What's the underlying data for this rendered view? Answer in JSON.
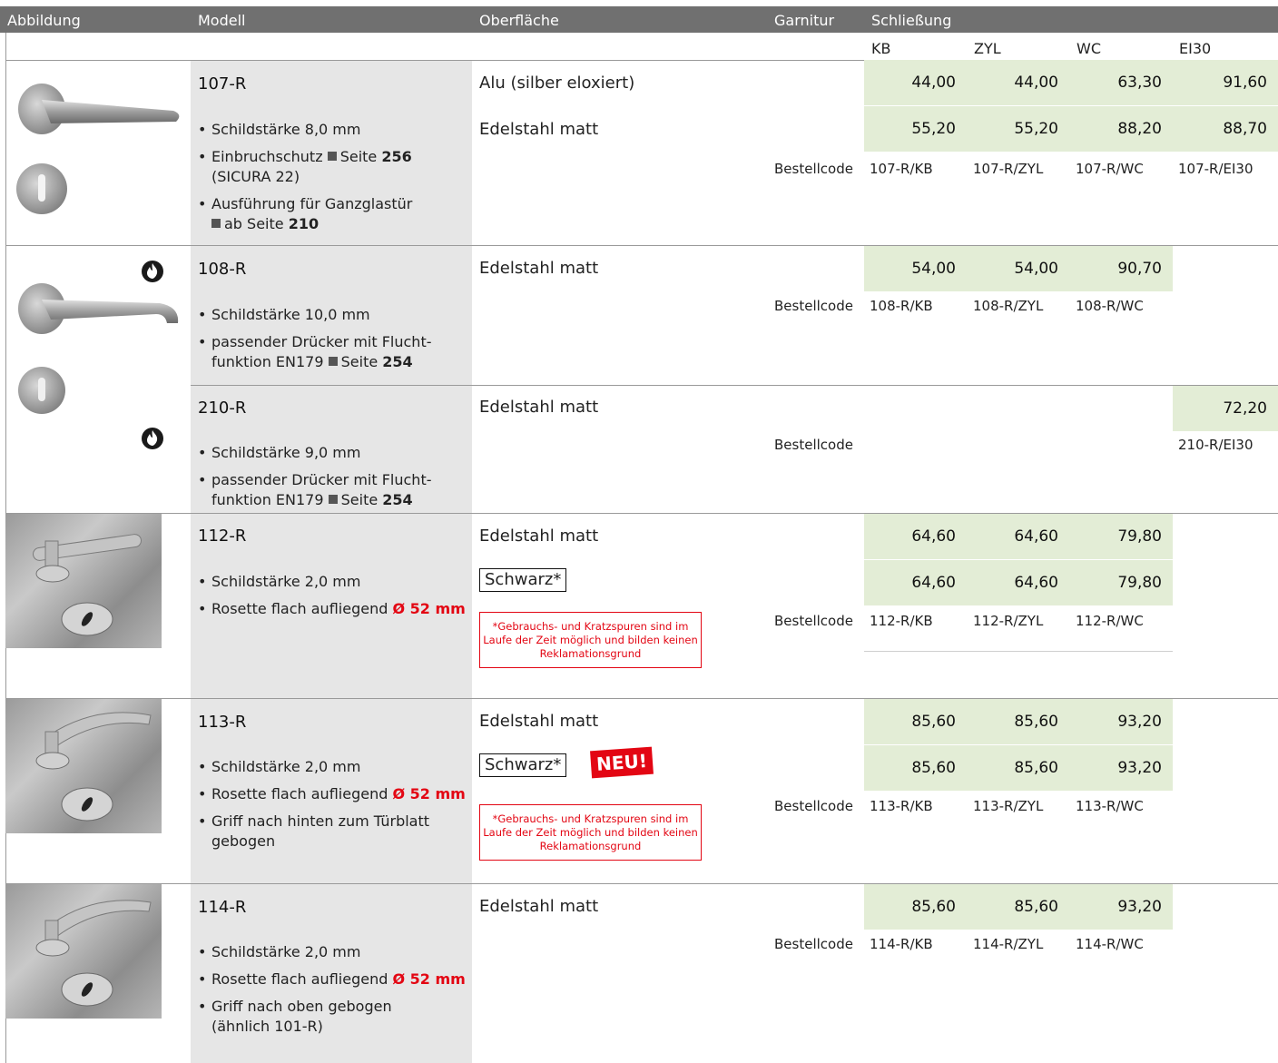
{
  "header": {
    "abbildung": "Abbildung",
    "modell": "Modell",
    "oberflaeche": "Oberfläche",
    "garnitur": "Garnitur",
    "schliessung": "Schließung"
  },
  "columns": {
    "kb": "KB",
    "zyl": "ZYL",
    "wc": "WC",
    "ei30": "EI30"
  },
  "bestellcode_label": "Bestellcode",
  "note_text": "*Gebrauchs- und Kratzspuren sind im Laufe der Zeit möglich und bilden keinen Reklamationsgrund",
  "neu_badge": "NEU!",
  "rows": {
    "r107": {
      "model": "107-R",
      "bullets": {
        "b1": "Schildstärke 8,0 mm",
        "b2a": "Einbruchschutz",
        "b2b": "Seite",
        "b2c": "256",
        "b2d": "(SICURA 22)",
        "b3a": "Ausführung für Ganzglastür",
        "b3b": "ab Seite",
        "b3c": "210"
      },
      "finishes": [
        "Alu (silber eloxiert)",
        "Edelstahl matt"
      ],
      "prices": [
        [
          "44,00",
          "44,00",
          "63,30",
          "91,60"
        ],
        [
          "55,20",
          "55,20",
          "88,20",
          "88,70"
        ]
      ],
      "codes": [
        "107-R/KB",
        "107-R/ZYL",
        "107-R/WC",
        "107-R/EI30"
      ]
    },
    "r108": {
      "model": "108-R",
      "bullets": {
        "b1": "Schildstärke 10,0 mm",
        "b2a": "passender Drücker mit Flucht-",
        "b2b": "funktion EN179",
        "b2c": "Seite",
        "b2d": "254"
      },
      "finishes": [
        "Edelstahl matt"
      ],
      "prices": [
        [
          "54,00",
          "54,00",
          "90,70"
        ]
      ],
      "codes": [
        "108-R/KB",
        "108-R/ZYL",
        "108-R/WC"
      ]
    },
    "r210": {
      "model": "210-R",
      "bullets": {
        "b1": "Schildstärke 9,0 mm",
        "b2a": "passender Drücker mit Flucht-",
        "b2b": "funktion EN179",
        "b2c": "Seite",
        "b2d": "254"
      },
      "finishes": [
        "Edelstahl matt"
      ],
      "price_ei30": "72,20",
      "code_ei30": "210-R/EI30"
    },
    "r112": {
      "model": "112-R",
      "bullets": {
        "b1": "Schildstärke 2,0 mm",
        "b2a": "Rosette flach aufliegend",
        "b2b": "Ø 52 mm"
      },
      "finishes": [
        "Edelstahl matt",
        "Schwarz*"
      ],
      "prices": [
        [
          "64,60",
          "64,60",
          "79,80"
        ],
        [
          "64,60",
          "64,60",
          "79,80"
        ]
      ],
      "codes": [
        "112-R/KB",
        "112-R/ZYL",
        "112-R/WC"
      ]
    },
    "r113": {
      "model": "113-R",
      "bullets": {
        "b1": "Schildstärke 2,0 mm",
        "b2a": "Rosette flach aufliegend",
        "b2b": "Ø 52 mm",
        "b3a": "Griff nach hinten zum Türblatt",
        "b3b": "gebogen"
      },
      "finishes": [
        "Edelstahl matt",
        "Schwarz*"
      ],
      "prices": [
        [
          "85,60",
          "85,60",
          "93,20"
        ],
        [
          "85,60",
          "85,60",
          "93,20"
        ]
      ],
      "codes": [
        "113-R/KB",
        "113-R/ZYL",
        "113-R/WC"
      ]
    },
    "r114": {
      "model": "114-R",
      "bullets": {
        "b1": "Schildstärke 2,0 mm",
        "b2a": "Rosette flach aufliegend",
        "b2b": "Ø 52 mm",
        "b3a": "Griff nach oben gebogen",
        "b3b": "(ähnlich 101-R)"
      },
      "finishes": [
        "Edelstahl matt"
      ],
      "prices": [
        [
          "85,60",
          "85,60",
          "93,20"
        ]
      ],
      "codes": [
        "114-R/KB",
        "114-R/ZYL",
        "114-R/WC"
      ]
    }
  },
  "icons": {
    "fire": "fire-rating-icon",
    "handle": "door-handle-image",
    "escutcheon": "key-escutcheon-image"
  },
  "colors": {
    "header_bg": "#707070",
    "price_bg": "#e3edd6",
    "model_bg": "#e6e6e6",
    "accent_red": "#e30613"
  }
}
